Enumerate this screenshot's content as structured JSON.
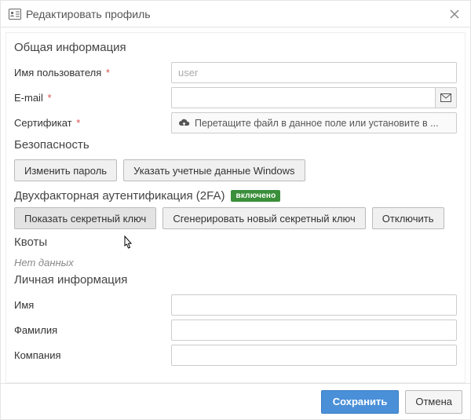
{
  "dialog": {
    "title": "Редактировать профиль"
  },
  "sections": {
    "general": "Общая информация",
    "security": "Безопасность",
    "twofa": "Двухфакторная аутентификация (2FA)",
    "quotas": "Квоты",
    "personal": "Личная информация"
  },
  "general": {
    "username_label": "Имя пользователя",
    "username_value": "user",
    "email_label": "E-mail",
    "email_value": "",
    "cert_label": "Сертификат",
    "cert_placeholder": "Перетащите файл в данное поле или установите в ..."
  },
  "security": {
    "change_password": "Изменить пароль",
    "windows_creds": "Указать учетные данные Windows"
  },
  "twofa": {
    "badge": "включено",
    "show_secret": "Показать секретный ключ",
    "regen_secret": "Сгенерировать новый секретный ключ",
    "disable": "Отключить"
  },
  "quotas": {
    "nodata": "Нет данных"
  },
  "personal": {
    "firstname_label": "Имя",
    "firstname_value": "",
    "lastname_label": "Фамилия",
    "lastname_value": "",
    "company_label": "Компания",
    "company_value": ""
  },
  "footer": {
    "save": "Сохранить",
    "cancel": "Отмена"
  }
}
